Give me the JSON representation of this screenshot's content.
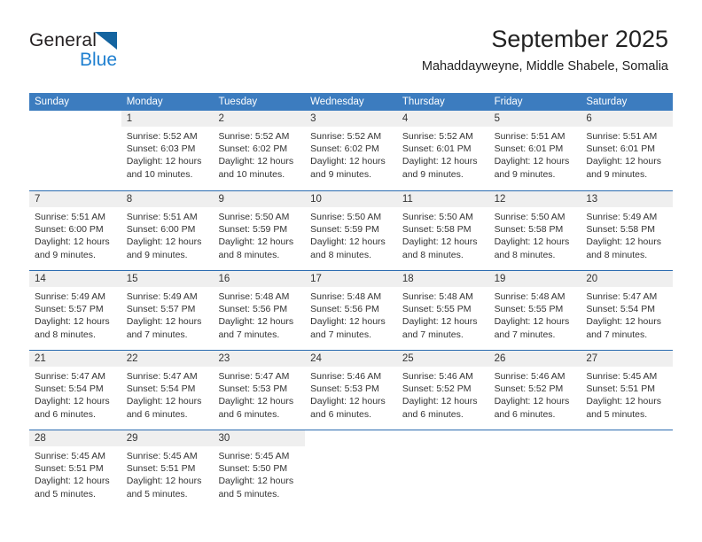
{
  "brand": {
    "name_part1": "General",
    "name_part2": "Blue",
    "logo_icon": "triangle-logo-icon"
  },
  "header": {
    "month_title": "September 2025",
    "location": "Mahaddayweyne, Middle Shabele, Somalia"
  },
  "colors": {
    "header_blue": "#3c7cbf",
    "row_border_blue": "#2a6bb0",
    "day_band_gray": "#efefef",
    "brand_blue": "#2080d0",
    "logo_blue": "#1464a0"
  },
  "weekdays": [
    "Sunday",
    "Monday",
    "Tuesday",
    "Wednesday",
    "Thursday",
    "Friday",
    "Saturday"
  ],
  "weeks": [
    [
      {
        "day": "",
        "lines": [],
        "empty": true
      },
      {
        "day": "1",
        "lines": [
          "Sunrise: 5:52 AM",
          "Sunset: 6:03 PM",
          "Daylight: 12 hours and 10 minutes."
        ]
      },
      {
        "day": "2",
        "lines": [
          "Sunrise: 5:52 AM",
          "Sunset: 6:02 PM",
          "Daylight: 12 hours and 10 minutes."
        ]
      },
      {
        "day": "3",
        "lines": [
          "Sunrise: 5:52 AM",
          "Sunset: 6:02 PM",
          "Daylight: 12 hours and 9 minutes."
        ]
      },
      {
        "day": "4",
        "lines": [
          "Sunrise: 5:52 AM",
          "Sunset: 6:01 PM",
          "Daylight: 12 hours and 9 minutes."
        ]
      },
      {
        "day": "5",
        "lines": [
          "Sunrise: 5:51 AM",
          "Sunset: 6:01 PM",
          "Daylight: 12 hours and 9 minutes."
        ]
      },
      {
        "day": "6",
        "lines": [
          "Sunrise: 5:51 AM",
          "Sunset: 6:01 PM",
          "Daylight: 12 hours and 9 minutes."
        ]
      }
    ],
    [
      {
        "day": "7",
        "lines": [
          "Sunrise: 5:51 AM",
          "Sunset: 6:00 PM",
          "Daylight: 12 hours and 9 minutes."
        ]
      },
      {
        "day": "8",
        "lines": [
          "Sunrise: 5:51 AM",
          "Sunset: 6:00 PM",
          "Daylight: 12 hours and 9 minutes."
        ]
      },
      {
        "day": "9",
        "lines": [
          "Sunrise: 5:50 AM",
          "Sunset: 5:59 PM",
          "Daylight: 12 hours and 8 minutes."
        ]
      },
      {
        "day": "10",
        "lines": [
          "Sunrise: 5:50 AM",
          "Sunset: 5:59 PM",
          "Daylight: 12 hours and 8 minutes."
        ]
      },
      {
        "day": "11",
        "lines": [
          "Sunrise: 5:50 AM",
          "Sunset: 5:58 PM",
          "Daylight: 12 hours and 8 minutes."
        ]
      },
      {
        "day": "12",
        "lines": [
          "Sunrise: 5:50 AM",
          "Sunset: 5:58 PM",
          "Daylight: 12 hours and 8 minutes."
        ]
      },
      {
        "day": "13",
        "lines": [
          "Sunrise: 5:49 AM",
          "Sunset: 5:58 PM",
          "Daylight: 12 hours and 8 minutes."
        ]
      }
    ],
    [
      {
        "day": "14",
        "lines": [
          "Sunrise: 5:49 AM",
          "Sunset: 5:57 PM",
          "Daylight: 12 hours and 8 minutes."
        ]
      },
      {
        "day": "15",
        "lines": [
          "Sunrise: 5:49 AM",
          "Sunset: 5:57 PM",
          "Daylight: 12 hours and 7 minutes."
        ]
      },
      {
        "day": "16",
        "lines": [
          "Sunrise: 5:48 AM",
          "Sunset: 5:56 PM",
          "Daylight: 12 hours and 7 minutes."
        ]
      },
      {
        "day": "17",
        "lines": [
          "Sunrise: 5:48 AM",
          "Sunset: 5:56 PM",
          "Daylight: 12 hours and 7 minutes."
        ]
      },
      {
        "day": "18",
        "lines": [
          "Sunrise: 5:48 AM",
          "Sunset: 5:55 PM",
          "Daylight: 12 hours and 7 minutes."
        ]
      },
      {
        "day": "19",
        "lines": [
          "Sunrise: 5:48 AM",
          "Sunset: 5:55 PM",
          "Daylight: 12 hours and 7 minutes."
        ]
      },
      {
        "day": "20",
        "lines": [
          "Sunrise: 5:47 AM",
          "Sunset: 5:54 PM",
          "Daylight: 12 hours and 7 minutes."
        ]
      }
    ],
    [
      {
        "day": "21",
        "lines": [
          "Sunrise: 5:47 AM",
          "Sunset: 5:54 PM",
          "Daylight: 12 hours and 6 minutes."
        ]
      },
      {
        "day": "22",
        "lines": [
          "Sunrise: 5:47 AM",
          "Sunset: 5:54 PM",
          "Daylight: 12 hours and 6 minutes."
        ]
      },
      {
        "day": "23",
        "lines": [
          "Sunrise: 5:47 AM",
          "Sunset: 5:53 PM",
          "Daylight: 12 hours and 6 minutes."
        ]
      },
      {
        "day": "24",
        "lines": [
          "Sunrise: 5:46 AM",
          "Sunset: 5:53 PM",
          "Daylight: 12 hours and 6 minutes."
        ]
      },
      {
        "day": "25",
        "lines": [
          "Sunrise: 5:46 AM",
          "Sunset: 5:52 PM",
          "Daylight: 12 hours and 6 minutes."
        ]
      },
      {
        "day": "26",
        "lines": [
          "Sunrise: 5:46 AM",
          "Sunset: 5:52 PM",
          "Daylight: 12 hours and 6 minutes."
        ]
      },
      {
        "day": "27",
        "lines": [
          "Sunrise: 5:45 AM",
          "Sunset: 5:51 PM",
          "Daylight: 12 hours and 5 minutes."
        ]
      }
    ],
    [
      {
        "day": "28",
        "lines": [
          "Sunrise: 5:45 AM",
          "Sunset: 5:51 PM",
          "Daylight: 12 hours and 5 minutes."
        ]
      },
      {
        "day": "29",
        "lines": [
          "Sunrise: 5:45 AM",
          "Sunset: 5:51 PM",
          "Daylight: 12 hours and 5 minutes."
        ]
      },
      {
        "day": "30",
        "lines": [
          "Sunrise: 5:45 AM",
          "Sunset: 5:50 PM",
          "Daylight: 12 hours and 5 minutes."
        ]
      },
      {
        "day": "",
        "lines": [],
        "empty": true
      },
      {
        "day": "",
        "lines": [],
        "empty": true
      },
      {
        "day": "",
        "lines": [],
        "empty": true
      },
      {
        "day": "",
        "lines": [],
        "empty": true
      }
    ]
  ]
}
